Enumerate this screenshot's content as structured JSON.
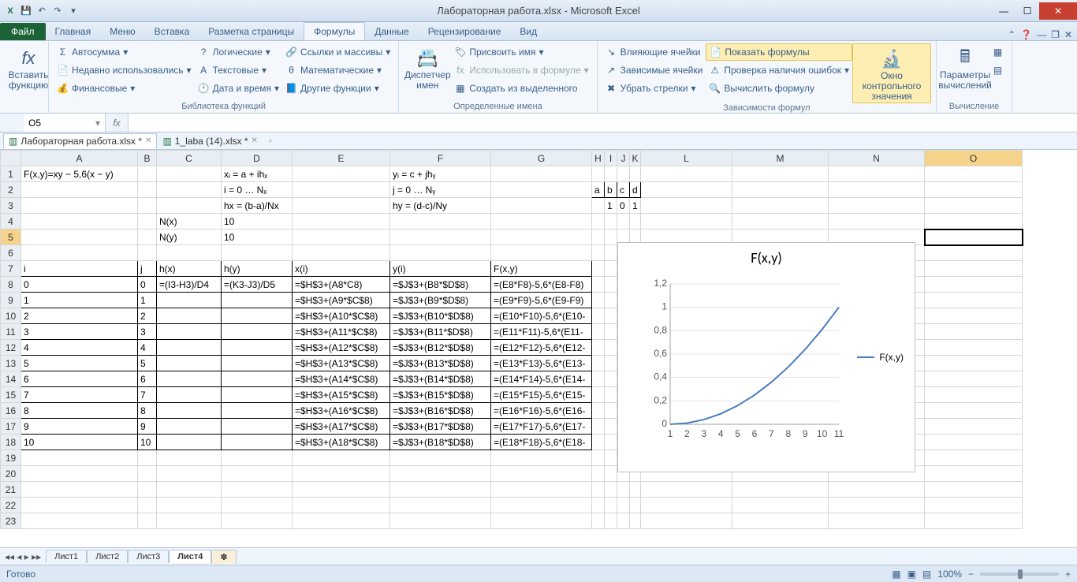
{
  "title": "Лабораторная работа.xlsx - Microsoft Excel",
  "qat": [
    "X",
    "💾",
    "↶",
    "↷",
    "≡"
  ],
  "tabs": [
    "Главная",
    "Меню",
    "Вставка",
    "Разметка страницы",
    "Формулы",
    "Данные",
    "Рецензирование",
    "Вид"
  ],
  "activeTab": "Формулы",
  "file": "Файл",
  "ribbon": {
    "g1": {
      "big": "Вставить\nфункцию",
      "bicon": "fx"
    },
    "g2": {
      "items": [
        "Автосумма",
        "Недавно использовались",
        "Финансовые"
      ],
      "items2": [
        "Логические",
        "Текстовые",
        "Дата и время"
      ],
      "items3": [
        "Ссылки и массивы",
        "Математические",
        "Другие функции"
      ],
      "label": "Библиотека функций"
    },
    "g3": {
      "big": "Диспетчер\nимен",
      "items": [
        "Присвоить имя",
        "Использовать в формуле",
        "Создать из выделенного"
      ],
      "label": "Определенные имена"
    },
    "g4": {
      "l": [
        "Влияющие ячейки",
        "Зависимые ячейки",
        "Убрать стрелки"
      ],
      "r": [
        "Показать формулы",
        "Проверка наличия ошибок",
        "Вычислить формулу"
      ],
      "big": "Окно контрольного\nзначения",
      "label": "Зависимости формул"
    },
    "g5": {
      "big": "Параметры\nвычислений",
      "label": "Вычисление"
    }
  },
  "namebox": "O5",
  "fx": "",
  "docs": [
    {
      "t": "Лабораторная работа.xlsx *",
      "a": true
    },
    {
      "t": "1_laba (14).xlsx *",
      "a": false
    }
  ],
  "cols": [
    "A",
    "B",
    "C",
    "D",
    "E",
    "F",
    "G",
    "H",
    "I",
    "J",
    "K",
    "L",
    "M",
    "N",
    "O"
  ],
  "rows": [
    {
      "n": 1,
      "A": "F(x,y)=xy − 5,6(x − y)",
      "D": "xᵢ = a + ihₓ",
      "F": "yᵢ = c + jhᵧ"
    },
    {
      "n": 2,
      "D": "i = 0 … Nₓ",
      "F": "j = 0 … Nᵧ",
      "H": "a",
      "I": "b",
      "J": "c",
      "K": "d",
      "border": "HIJK"
    },
    {
      "n": 3,
      "D": "hx = (b-a)/Nx",
      "F": "hy = (d-c)/Ny",
      "I": "1",
      "J": "0",
      "K": "1"
    },
    {
      "n": 4,
      "C": "N(x)",
      "D": "10"
    },
    {
      "n": 5,
      "C": "N(y)",
      "D": "10",
      "sel": "O"
    },
    {
      "n": 6
    },
    {
      "n": 7,
      "A": "i",
      "B": "j",
      "C": "h(x)",
      "D": "h(y)",
      "E": "x(i)",
      "F": "y(i)",
      "G": "F(x,y)",
      "border": "ABCDEFG"
    },
    {
      "n": 8,
      "A": "0",
      "B": "0",
      "C": "=(I3-H3)/D4",
      "D": "=(K3-J3)/D5",
      "E": "=$H$3+(A8*C8)",
      "F": "=$J$3+(B8*$D$8)",
      "G": "=(E8*F8)-5,6*(E8-F8)",
      "border": "ABCDEFG"
    },
    {
      "n": 9,
      "A": "1",
      "B": "1",
      "E": "=$H$3+(A9*$C$8)",
      "F": "=$J$3+(B9*$D$8)",
      "G": "=(E9*F9)-5,6*(E9-F9)",
      "border": "ABCDEFG"
    },
    {
      "n": 10,
      "A": "2",
      "B": "2",
      "E": "=$H$3+(A10*$C$8)",
      "F": "=$J$3+(B10*$D$8)",
      "G": "=(E10*F10)-5,6*(E10-",
      "border": "ABCDEFG"
    },
    {
      "n": 11,
      "A": "3",
      "B": "3",
      "E": "=$H$3+(A11*$C$8)",
      "F": "=$J$3+(B11*$D$8)",
      "G": "=(E11*F11)-5,6*(E11-",
      "border": "ABCDEFG"
    },
    {
      "n": 12,
      "A": "4",
      "B": "4",
      "E": "=$H$3+(A12*$C$8)",
      "F": "=$J$3+(B12*$D$8)",
      "G": "=(E12*F12)-5,6*(E12-",
      "border": "ABCDEFG"
    },
    {
      "n": 13,
      "A": "5",
      "B": "5",
      "E": "=$H$3+(A13*$C$8)",
      "F": "=$J$3+(B13*$D$8)",
      "G": "=(E13*F13)-5,6*(E13-",
      "border": "ABCDEFG"
    },
    {
      "n": 14,
      "A": "6",
      "B": "6",
      "E": "=$H$3+(A14*$C$8)",
      "F": "=$J$3+(B14*$D$8)",
      "G": "=(E14*F14)-5,6*(E14-",
      "border": "ABCDEFG"
    },
    {
      "n": 15,
      "A": "7",
      "B": "7",
      "E": "=$H$3+(A15*$C$8)",
      "F": "=$J$3+(B15*$D$8)",
      "G": "=(E15*F15)-5,6*(E15-",
      "border": "ABCDEFG"
    },
    {
      "n": 16,
      "A": "8",
      "B": "8",
      "E": "=$H$3+(A16*$C$8)",
      "F": "=$J$3+(B16*$D$8)",
      "G": "=(E16*F16)-5,6*(E16-",
      "border": "ABCDEFG"
    },
    {
      "n": 17,
      "A": "9",
      "B": "9",
      "E": "=$H$3+(A17*$C$8)",
      "F": "=$J$3+(B17*$D$8)",
      "G": "=(E17*F17)-5,6*(E17-",
      "border": "ABCDEFG"
    },
    {
      "n": 18,
      "A": "10",
      "B": "10",
      "E": "=$H$3+(A18*$C$8)",
      "F": "=$J$3+(B18*$D$8)",
      "G": "=(E18*F18)-5,6*(E18-",
      "border": "ABCDEFG"
    },
    {
      "n": 19
    },
    {
      "n": 20
    },
    {
      "n": 21
    },
    {
      "n": 22
    },
    {
      "n": 23
    }
  ],
  "chart_data": {
    "type": "line",
    "title": "F(x,y)",
    "series": [
      {
        "name": "F(x,y)",
        "values": [
          0,
          0.01,
          0.04,
          0.09,
          0.16,
          0.25,
          0.36,
          0.49,
          0.64,
          0.81,
          1.0
        ]
      }
    ],
    "categories": [
      "1",
      "2",
      "3",
      "4",
      "5",
      "6",
      "7",
      "8",
      "9",
      "10",
      "11"
    ],
    "y_ticks": [
      "0",
      "0,2",
      "0,4",
      "0,6",
      "0,8",
      "1",
      "1,2"
    ],
    "ylim": [
      0,
      1.2
    ]
  },
  "sheets": [
    "Лист1",
    "Лист2",
    "Лист3",
    "Лист4"
  ],
  "activeSheet": "Лист4",
  "status": "Готово",
  "zoom": "100%"
}
